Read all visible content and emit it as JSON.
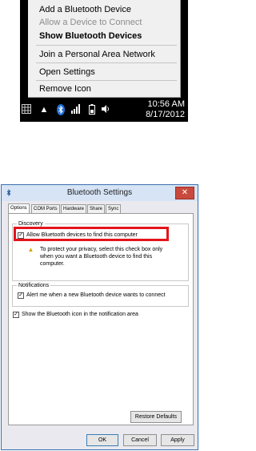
{
  "context_menu": {
    "items": [
      {
        "label": "Add a Bluetooth Device",
        "state": "normal"
      },
      {
        "label": "Allow a Device to Connect",
        "state": "disabled"
      },
      {
        "label": "Show Bluetooth Devices",
        "state": "bold"
      },
      {
        "label": "Join a Personal Area Network",
        "state": "normal"
      },
      {
        "label": "Open Settings",
        "state": "normal"
      },
      {
        "label": "Remove Icon",
        "state": "normal"
      }
    ]
  },
  "taskbar": {
    "time": "10:56 AM",
    "date": "8/17/2012",
    "icons": [
      "show-desktop-icon",
      "chevron-up-icon",
      "bluetooth-icon",
      "network-icon",
      "battery-icon",
      "volume-icon"
    ]
  },
  "dialog": {
    "title": "Bluetooth Settings",
    "close_label": "✕",
    "tabs": [
      {
        "label": "Options",
        "active": true
      },
      {
        "label": "COM Ports",
        "active": false
      },
      {
        "label": "Hardware",
        "active": false
      },
      {
        "label": "Share",
        "active": false
      },
      {
        "label": "Sync",
        "active": false
      }
    ],
    "discovery": {
      "label": "Discovery",
      "checkbox_label": "Allow Bluetooth devices to find this computer",
      "checked": true,
      "warning_lines": [
        "To protect your privacy, select this check box only",
        "when you want a Bluetooth device to find this",
        "computer."
      ]
    },
    "notifications": {
      "label": "Notifications",
      "checkbox_label": "Alert me when a new Bluetooth device wants to connect",
      "checked": true
    },
    "show_icon": {
      "checkbox_label": "Show the Bluetooth icon in the notification area",
      "checked": true
    },
    "restore_defaults_label": "Restore Defaults",
    "ok_label": "OK",
    "cancel_label": "Cancel",
    "apply_label": "Apply",
    "highlight_color": "#e3141b"
  }
}
